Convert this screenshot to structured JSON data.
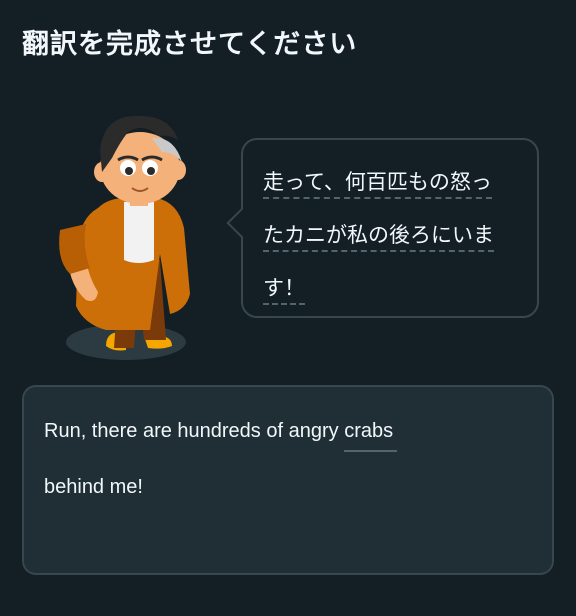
{
  "header": {
    "title": "翻訳を完成させてください"
  },
  "prompt": {
    "character": "duolingo-character-avatar",
    "lines": [
      "走って、何百匹もの怒っ",
      "たカニが私の後ろにいま",
      "す！"
    ]
  },
  "answer": {
    "prefix": "Run, there are hundreds of angry ",
    "filled_word": "crabs",
    "suffix": "behind me!"
  },
  "colors": {
    "background": "#131f24",
    "bubble_border": "#37464f",
    "answer_background": "#202f36",
    "dashed_underline": "#52656d",
    "character_coat": "#cc6f09"
  }
}
